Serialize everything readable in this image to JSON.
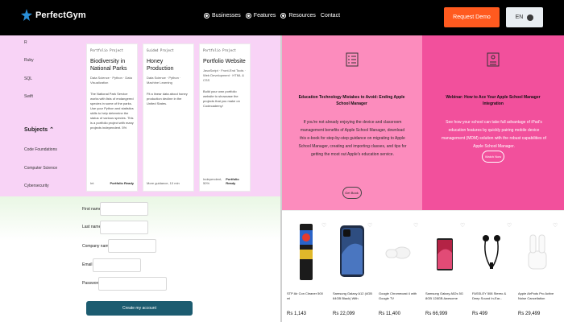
{
  "header": {
    "brand": "PerfectGym",
    "nav": [
      {
        "label": "Businesses"
      },
      {
        "label": "Features"
      },
      {
        "label": "Resources"
      },
      {
        "label": "Contact"
      }
    ],
    "demo_button": "Request Demo",
    "lang_button": "EN"
  },
  "catalog": {
    "filters": [
      "R",
      "Ruby",
      "SQL",
      "Swift"
    ],
    "subjects_heading": "Subjects",
    "subjects": [
      "Code Foundations",
      "Computer Science",
      "Cybersecurity"
    ],
    "cards": [
      {
        "kicker": "Portfolio Project",
        "title": "Biodiversity in National Parks",
        "tags": "Data Science · Python · Data Visualization",
        "desc": "The National Park Service works with lists of endangered species in some of the parks. Use your Python and statistics skills to help determine the status of various species. This is a portfolio project with many projects independent. 5%",
        "foot": "Int",
        "badge": "Portfolio Ready"
      },
      {
        "kicker": "Guided Project",
        "title": "Honey Production",
        "tags": "Data Science · Python · Machine Learning",
        "desc": "Fit a linear data about honey production decline in the United States.",
        "foot": "More guidance, 10 min",
        "badge": ""
      },
      {
        "kicker": "Portfolio Project",
        "title": "Portfolio Website",
        "tags": "JavaScript · Front-End Tools · Web Development · HTML & CSS",
        "desc": "Build your own portfolio website to showcase the projects that you make on Codecademy!",
        "foot": "Independent, 50%",
        "badge": "Portfolio Ready"
      }
    ]
  },
  "form": {
    "fields": [
      {
        "label": "First name"
      },
      {
        "label": "Last name"
      },
      {
        "label": "Company name"
      },
      {
        "label": "Email"
      },
      {
        "label": "Password"
      }
    ],
    "submit": "Create my account"
  },
  "promos": [
    {
      "title": "Education Technology Mistakes to Avoid: Ending Apple School Manager",
      "text": "If you're not already enjoying the device and classroom management benefits of Apple School Manager, download this e-book for step-by-step guidance on migrating to Apple School Manager, creating and importing classes, and tips for getting the most out Apple's education service.",
      "button": "Get Book"
    },
    {
      "title": "Webinar: How to Ace Your Apple School Manager Integration",
      "text": "See how your school can take full advantage of iPad's education features by quickly pairing mobile device management (MDM) solution with the robust capabilities of Apple School Manager.",
      "button": "Watch Now"
    }
  ],
  "products": [
    {
      "name": "STP Air Con Cleaner 500 ml",
      "price": "Rs 1,143"
    },
    {
      "name": "Samsung Galaxy A12 (4GB 64GB Black) With",
      "price": "Rs 22,099"
    },
    {
      "name": "Google Chromecast 4 with Google TV",
      "price": "Rs 11,400"
    },
    {
      "name": "Samsung Galaxy A52s 5G 8GB 128GB Awesome",
      "price": "Rs 66,999"
    },
    {
      "name": "FASSLEY 508 Stereo & Deep Sound In-Ear...",
      "price": "Rs 499"
    },
    {
      "name": "Apple AirPods Pro Active Noise Cancellation",
      "price": "Rs 29,499"
    }
  ],
  "colors": {
    "accent": "#ff5a1f",
    "promo_light": "#fc8cbd",
    "promo_dark": "#f2509c",
    "catalog_bg": "#f8d3f6",
    "submit_bg": "#1c5c70"
  }
}
